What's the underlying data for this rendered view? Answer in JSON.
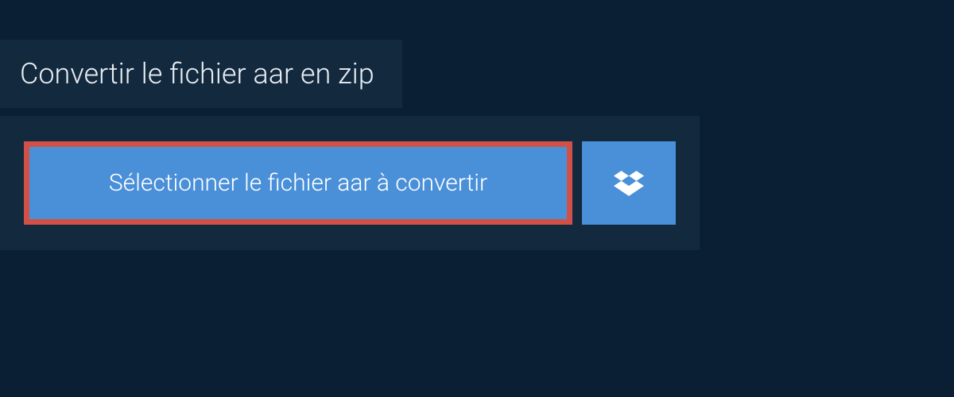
{
  "header": {
    "title": "Convertir le fichier aar en zip"
  },
  "main": {
    "select_file_label": "Sélectionner le fichier aar à convertir"
  }
}
